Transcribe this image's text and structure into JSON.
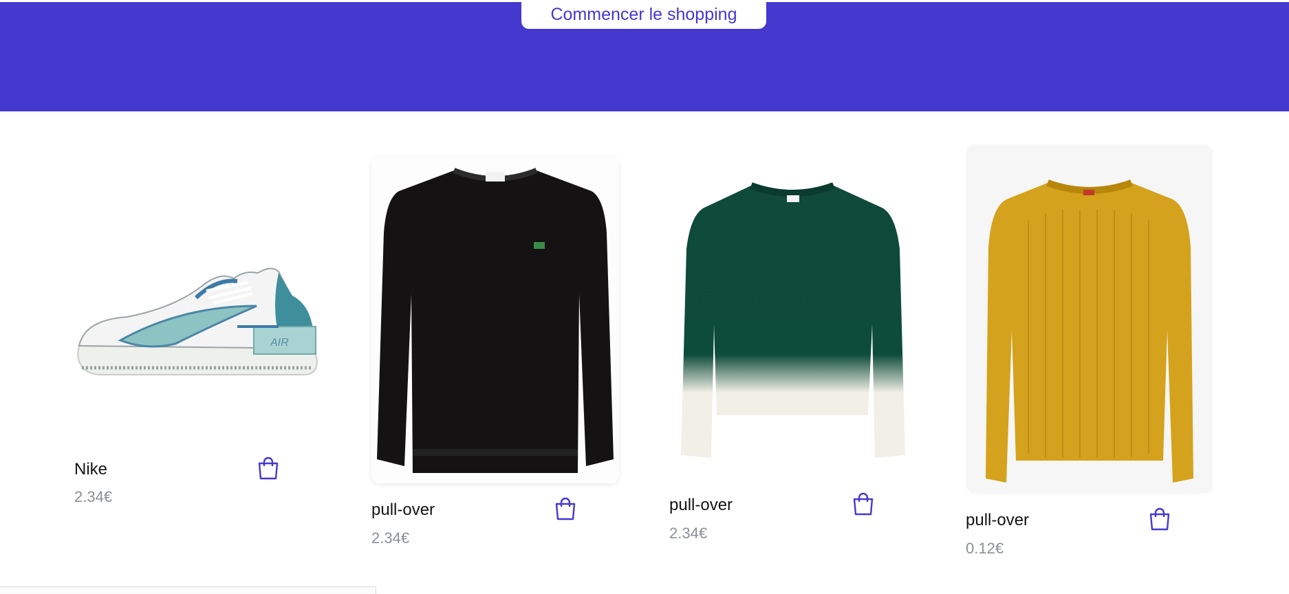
{
  "hero": {
    "cta_label": "Commencer le shopping",
    "background": "#4438cf"
  },
  "products": [
    {
      "name": "Nike",
      "price": "2.34€",
      "image": "white-teal-sneaker",
      "cart_icon": "shopping-bag-icon"
    },
    {
      "name": "pull-over",
      "price": "2.34€",
      "image": "black-crew-neck-sweater",
      "cart_icon": "shopping-bag-icon"
    },
    {
      "name": "pull-over",
      "price": "2.34€",
      "image": "green-dip-dye-sweater",
      "cart_icon": "shopping-bag-icon"
    },
    {
      "name": "pull-over",
      "price": "0.12€",
      "image": "mustard-knit-sweater",
      "cart_icon": "shopping-bag-icon"
    }
  ],
  "colors": {
    "accent": "#4438cf",
    "price": "#8a8f98",
    "text": "#141414"
  }
}
